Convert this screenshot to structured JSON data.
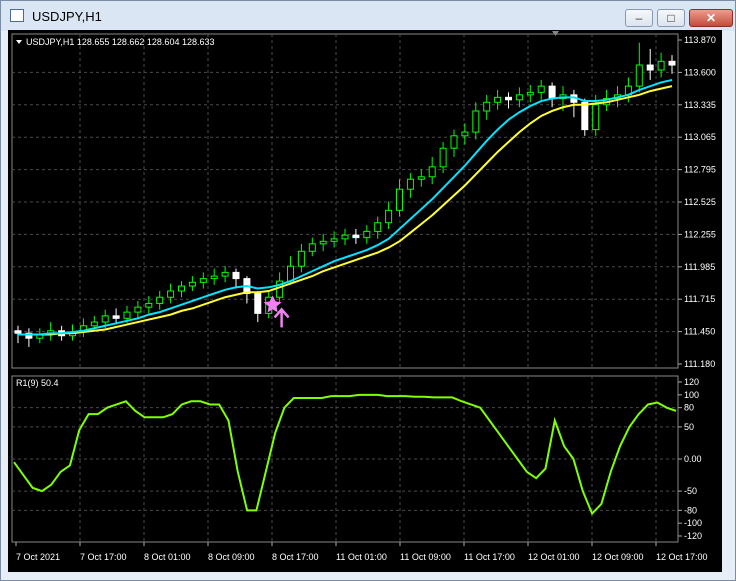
{
  "window": {
    "title": "USDJPY,H1",
    "min_icon": "minimize-icon",
    "max_icon": "maximize-icon",
    "close_icon": "close-icon"
  },
  "price_panel": {
    "header": "USDJPY,H1  128.655 128.662 128.604 128.633",
    "y_ticks": [
      "113.870",
      "113.600",
      "113.335",
      "113.065",
      "112.795",
      "112.525",
      "112.255",
      "111.985",
      "111.715",
      "111.450",
      "111.180"
    ],
    "signal_icon": "buy-arrow-icon",
    "colors": {
      "bull": "#00ff00",
      "bear": "#ffffff",
      "ma_fast": "#00e5ff",
      "ma_slow": "#ffff33",
      "signal": "#ee82ee"
    }
  },
  "indicator_panel": {
    "header": "R1(9) 50.4",
    "y_ticks": [
      "120",
      "100",
      "80",
      "50",
      "0.00",
      "-50",
      "-80",
      "-100",
      "-120"
    ],
    "color": "#7fff00"
  },
  "x_axis": {
    "ticks": [
      "7 Oct 2021",
      "7 Oct 17:00",
      "8 Oct 01:00",
      "8 Oct 09:00",
      "8 Oct 17:00",
      "11 Oct 01:00",
      "11 Oct 09:00",
      "11 Oct 17:00",
      "12 Oct 01:00",
      "12 Oct 09:00",
      "12 Oct 17:00"
    ]
  },
  "chart_data": {
    "type": "line",
    "price": {
      "ylim": [
        111.18,
        113.87
      ],
      "candles": [
        [
          111.48,
          111.46,
          111.52,
          111.38
        ],
        [
          111.46,
          111.42,
          111.5,
          111.35
        ],
        [
          111.42,
          111.45,
          111.5,
          111.38
        ],
        [
          111.45,
          111.48,
          111.55,
          111.4
        ],
        [
          111.48,
          111.44,
          111.52,
          111.4
        ],
        [
          111.44,
          111.47,
          111.53,
          111.4
        ],
        [
          111.47,
          111.52,
          111.58,
          111.43
        ],
        [
          111.52,
          111.55,
          111.6,
          111.48
        ],
        [
          111.55,
          111.6,
          111.65,
          111.5
        ],
        [
          111.6,
          111.58,
          111.66,
          111.53
        ],
        [
          111.58,
          111.63,
          111.68,
          111.54
        ],
        [
          111.63,
          111.67,
          111.72,
          111.58
        ],
        [
          111.67,
          111.7,
          111.76,
          111.62
        ],
        [
          111.7,
          111.75,
          111.8,
          111.65
        ],
        [
          111.75,
          111.8,
          111.86,
          111.7
        ],
        [
          111.8,
          111.84,
          111.88,
          111.75
        ],
        [
          111.84,
          111.87,
          111.92,
          111.8
        ],
        [
          111.87,
          111.9,
          111.95,
          111.82
        ],
        [
          111.9,
          111.92,
          111.98,
          111.85
        ],
        [
          111.92,
          111.95,
          112.0,
          111.87
        ],
        [
          111.95,
          111.9,
          111.98,
          111.82
        ],
        [
          111.9,
          111.78,
          111.92,
          111.7
        ],
        [
          111.78,
          111.62,
          111.8,
          111.55
        ],
        [
          111.62,
          111.75,
          111.8,
          111.58
        ],
        [
          111.75,
          111.88,
          111.95,
          111.7
        ],
        [
          111.88,
          112.0,
          112.08,
          111.85
        ],
        [
          112.0,
          112.12,
          112.18,
          111.95
        ],
        [
          112.12,
          112.18,
          112.23,
          112.08
        ],
        [
          112.18,
          112.2,
          112.26,
          112.12
        ],
        [
          112.2,
          112.22,
          112.28,
          112.15
        ],
        [
          112.22,
          112.25,
          112.3,
          112.17
        ],
        [
          112.25,
          112.23,
          112.3,
          112.18
        ],
        [
          112.23,
          112.28,
          112.33,
          112.18
        ],
        [
          112.28,
          112.35,
          112.4,
          112.22
        ],
        [
          112.35,
          112.45,
          112.52,
          112.3
        ],
        [
          112.45,
          112.62,
          112.7,
          112.4
        ],
        [
          112.62,
          112.7,
          112.75,
          112.55
        ],
        [
          112.7,
          112.72,
          112.78,
          112.64
        ],
        [
          112.72,
          112.8,
          112.88,
          112.66
        ],
        [
          112.8,
          112.95,
          113.0,
          112.75
        ],
        [
          112.95,
          113.05,
          113.1,
          112.88
        ],
        [
          113.05,
          113.08,
          113.15,
          112.98
        ],
        [
          113.08,
          113.25,
          113.32,
          113.02
        ],
        [
          113.25,
          113.32,
          113.38,
          113.18
        ],
        [
          113.32,
          113.36,
          113.42,
          113.26
        ],
        [
          113.36,
          113.34,
          113.4,
          113.27
        ],
        [
          113.34,
          113.38,
          113.44,
          113.28
        ],
        [
          113.38,
          113.4,
          113.46,
          113.32
        ],
        [
          113.4,
          113.45,
          113.5,
          113.34
        ],
        [
          113.45,
          113.35,
          113.48,
          113.28
        ],
        [
          113.35,
          113.38,
          113.45,
          113.25
        ],
        [
          113.38,
          113.32,
          113.42,
          113.2
        ],
        [
          113.32,
          113.1,
          113.35,
          113.05
        ],
        [
          113.1,
          113.3,
          113.38,
          113.05
        ],
        [
          113.3,
          113.35,
          113.42,
          113.25
        ],
        [
          113.35,
          113.38,
          113.45,
          113.28
        ],
        [
          113.38,
          113.45,
          113.52,
          113.32
        ],
        [
          113.45,
          113.62,
          113.8,
          113.4
        ],
        [
          113.62,
          113.58,
          113.75,
          113.5
        ],
        [
          113.58,
          113.65,
          113.72,
          113.52
        ],
        [
          113.65,
          113.62,
          113.7,
          113.55
        ]
      ],
      "ma_fast": [
        111.45,
        111.45,
        111.45,
        111.46,
        111.46,
        111.47,
        111.48,
        111.5,
        111.52,
        111.54,
        111.56,
        111.58,
        111.61,
        111.63,
        111.66,
        111.69,
        111.72,
        111.75,
        111.78,
        111.81,
        111.83,
        111.84,
        111.82,
        111.83,
        111.85,
        111.88,
        111.92,
        111.96,
        112.0,
        112.04,
        112.07,
        112.1,
        112.13,
        112.17,
        112.22,
        112.3,
        112.38,
        112.46,
        112.54,
        112.63,
        112.72,
        112.81,
        112.91,
        113.01,
        113.1,
        113.18,
        113.24,
        113.29,
        113.33,
        113.35,
        113.36,
        113.36,
        113.33,
        113.33,
        113.34,
        113.36,
        113.38,
        113.42,
        113.45,
        113.48,
        113.5
      ],
      "ma_slow": [
        111.45,
        111.45,
        111.45,
        111.45,
        111.46,
        111.46,
        111.47,
        111.48,
        111.49,
        111.51,
        111.53,
        111.55,
        111.57,
        111.59,
        111.61,
        111.64,
        111.66,
        111.69,
        111.72,
        111.75,
        111.77,
        111.79,
        111.79,
        111.8,
        111.83,
        111.86,
        111.89,
        111.92,
        111.96,
        111.99,
        112.02,
        112.05,
        112.08,
        112.11,
        112.15,
        112.2,
        112.27,
        112.34,
        112.41,
        112.49,
        112.57,
        112.65,
        112.74,
        112.83,
        112.92,
        113.0,
        113.08,
        113.15,
        113.21,
        113.25,
        113.28,
        113.3,
        113.3,
        113.31,
        113.32,
        113.34,
        113.36,
        113.38,
        113.41,
        113.43,
        113.45
      ],
      "signal_index": 24
    },
    "indicator": {
      "name": "R1(9)",
      "ylim": [
        -120,
        120
      ],
      "values": [
        -5,
        -25,
        -45,
        -50,
        -40,
        -20,
        -10,
        45,
        70,
        70,
        80,
        85,
        90,
        75,
        65,
        65,
        65,
        70,
        85,
        90,
        90,
        85,
        85,
        60,
        -20,
        -80,
        -80,
        -20,
        40,
        80,
        95,
        95,
        95,
        95,
        98,
        98,
        98,
        100,
        100,
        100,
        98,
        98,
        98,
        97,
        97,
        96,
        96,
        96,
        90,
        85,
        80,
        60,
        40,
        20,
        0,
        -20,
        -30,
        -15,
        60,
        20,
        0,
        -50,
        -85,
        -70,
        -20,
        20,
        50,
        70,
        85,
        88,
        80,
        75
      ]
    }
  }
}
